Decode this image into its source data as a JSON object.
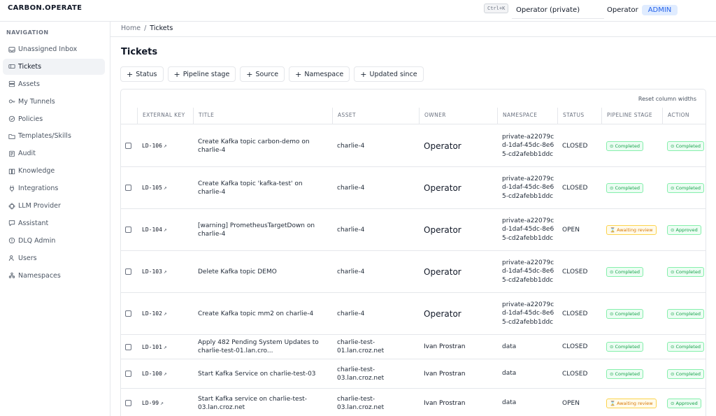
{
  "header": {
    "brand": "CARBON.OPERATE",
    "shortcut": "Ctrl+K",
    "namespace": "Operator (private)",
    "user": "Operator",
    "role": "ADMIN"
  },
  "sidebar": {
    "heading": "NAVIGATION",
    "items": [
      {
        "label": "Unassigned Inbox",
        "icon": "inbox-icon"
      },
      {
        "label": "Tickets",
        "icon": "ticket-icon",
        "active": true
      },
      {
        "label": "Assets",
        "icon": "server-icon"
      },
      {
        "label": "My Tunnels",
        "icon": "key-icon"
      },
      {
        "label": "Policies",
        "icon": "shield-check-icon"
      },
      {
        "label": "Templates/Skills",
        "icon": "folder-icon"
      },
      {
        "label": "Audit",
        "icon": "audit-icon"
      },
      {
        "label": "Knowledge",
        "icon": "book-icon"
      },
      {
        "label": "Integrations",
        "icon": "plug-icon"
      },
      {
        "label": "LLM Provider",
        "icon": "chip-icon"
      },
      {
        "label": "Assistant",
        "icon": "chat-icon"
      },
      {
        "label": "DLQ Admin",
        "icon": "alert-circle-icon"
      },
      {
        "label": "Users",
        "icon": "users-icon"
      },
      {
        "label": "Namespaces",
        "icon": "namespaces-icon"
      }
    ]
  },
  "breadcrumb": {
    "home": "Home",
    "separator": "/",
    "current": "Tickets"
  },
  "page": {
    "title": "Tickets"
  },
  "filters": [
    "Status",
    "Pipeline stage",
    "Source",
    "Namespace",
    "Updated since"
  ],
  "table": {
    "reset_label": "Reset column widths",
    "columns": [
      "EXTERNAL KEY",
      "TITLE",
      "ASSET",
      "OWNER",
      "NAMESPACE",
      "STATUS",
      "PIPELINE STAGE",
      "ACTION"
    ],
    "rows": [
      {
        "key": "LD-106",
        "title": "Create Kafka topic carbon-demo on charlie-4",
        "asset": "charlie-4",
        "owner": "Operator",
        "namespace": "private-a22079cd-1daf-45dc-8e65-cd2afebb1ddc",
        "status": "CLOSED",
        "stage": "Completed",
        "action": "Completed"
      },
      {
        "key": "LD-105",
        "title": "Create Kafka topic 'kafka-test' on charlie-4",
        "asset": "charlie-4",
        "owner": "Operator",
        "namespace": "private-a22079cd-1daf-45dc-8e65-cd2afebb1ddc",
        "status": "CLOSED",
        "stage": "Completed",
        "action": "Completed"
      },
      {
        "key": "LD-104",
        "title": "[warning] PrometheusTargetDown on charlie-4",
        "asset": "charlie-4",
        "owner": "Operator",
        "namespace": "private-a22079cd-1daf-45dc-8e65-cd2afebb1ddc",
        "status": "OPEN",
        "stage": "Awaiting review",
        "action": "Approved"
      },
      {
        "key": "LD-103",
        "title": "Delete Kafka topic DEMO",
        "asset": "charlie-4",
        "owner": "Operator",
        "namespace": "private-a22079cd-1daf-45dc-8e65-cd2afebb1ddc",
        "status": "CLOSED",
        "stage": "Completed",
        "action": "Completed"
      },
      {
        "key": "LD-102",
        "title": "Create Kafka topic mm2 on charlie-4",
        "asset": "charlie-4",
        "owner": "Operator",
        "namespace": "private-a22079cd-1daf-45dc-8e65-cd2afebb1ddc",
        "status": "CLOSED",
        "stage": "Completed",
        "action": "Completed"
      },
      {
        "key": "LD-101",
        "title": "Apply 482 Pending System Updates to charlie-test-01.lan.cro...",
        "asset": "charlie-test-01.lan.croz.net",
        "owner": "Ivan Prostran",
        "namespace": "data",
        "status": "CLOSED",
        "stage": "Completed",
        "action": "Completed"
      },
      {
        "key": "LD-100",
        "title": "Start Kafka Service on charlie-test-03",
        "asset": "charlie-test-03.lan.croz.net",
        "owner": "Ivan Prostran",
        "namespace": "data",
        "status": "CLOSED",
        "stage": "Completed",
        "action": "Completed"
      },
      {
        "key": "LD-99",
        "title": "Start Kafka service on charlie-test-03.lan.croz.net",
        "asset": "charlie-test-03.lan.croz.net",
        "owner": "Ivan Prostran",
        "namespace": "data",
        "status": "OPEN",
        "stage": "Awaiting review",
        "action": "Approved"
      }
    ]
  },
  "colors": {
    "accent": "#2563eb",
    "success": "#16a34a",
    "warning": "#d97706",
    "border": "#e5e7eb"
  }
}
